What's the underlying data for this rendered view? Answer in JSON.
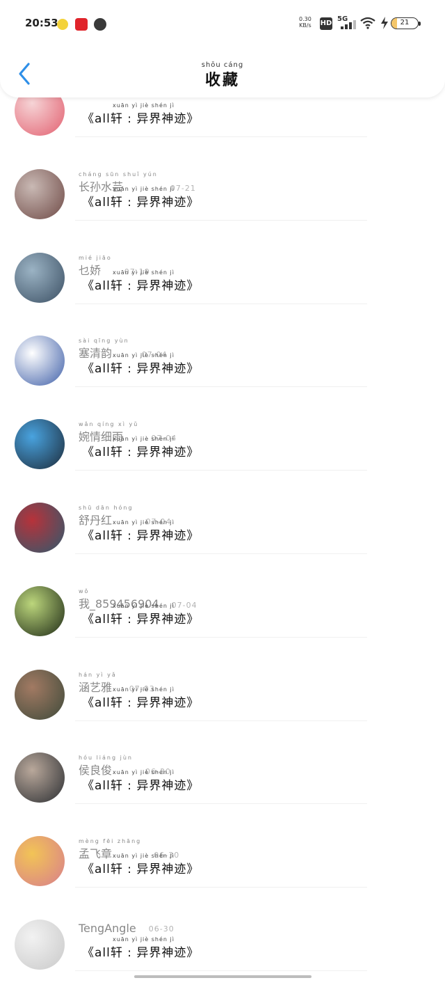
{
  "status": {
    "time": "20:53",
    "netspeed_value": "0.30",
    "netspeed_unit": "KB/s",
    "hd": "HD",
    "network": "5G",
    "battery": "21",
    "battery_level_pct": 21
  },
  "header": {
    "title_pinyin": "shōu cáng",
    "title": "收藏"
  },
  "quote": {
    "pinyin": "xuān         yì   jiè  shén  jì",
    "text": "《all轩 : 异界神迹》"
  },
  "items": [
    {
      "name_pinyin": "",
      "name": "",
      "date": "",
      "avatar_colors": [
        "#f6d4d6",
        "#e26070"
      ]
    },
    {
      "name_pinyin": "cháng sūn shuǐ yún",
      "name": "长孙水芸",
      "date": "07-21",
      "avatar_colors": [
        "#c9b9b4",
        "#6f4a46"
      ]
    },
    {
      "name_pinyin": "mié jiāo",
      "name": "乜娇",
      "date": "07-19",
      "avatar_colors": [
        "#9bb3c4",
        "#3b4f63"
      ]
    },
    {
      "name_pinyin": "sài qīng yùn",
      "name": "塞清韵",
      "date": "07-04",
      "avatar_colors": [
        "#ffffff",
        "#3f5fa8"
      ]
    },
    {
      "name_pinyin": "wǎn qíng xì yǔ",
      "name": "婉情细雨",
      "date": "07-04",
      "avatar_colors": [
        "#49a3df",
        "#1d2b3a"
      ]
    },
    {
      "name_pinyin": "shū dān hóng",
      "name": "舒丹红",
      "date": "07-04",
      "avatar_colors": [
        "#b7323a",
        "#2e5a6e"
      ]
    },
    {
      "name_pinyin": "wǒ",
      "name": "我_859456904",
      "date": "07-04",
      "avatar_colors": [
        "#bcd67c",
        "#1e2a16"
      ]
    },
    {
      "name_pinyin": "hán yì yǎ",
      "name": "涵艺雅",
      "date": "07-03",
      "avatar_colors": [
        "#a27a63",
        "#3e4a3a"
      ]
    },
    {
      "name_pinyin": "hóu liáng jùn",
      "name": "侯良俊",
      "date": "06-30",
      "avatar_colors": [
        "#b9a89b",
        "#2b2e32"
      ]
    },
    {
      "name_pinyin": "mèng fēi zhāng",
      "name": "孟飞章",
      "date": "06-30",
      "avatar_colors": [
        "#f2c456",
        "#d87e8c"
      ]
    },
    {
      "name_pinyin": "",
      "name": "TengAngle",
      "date": "06-30",
      "avatar_colors": [
        "#f2f2f2",
        "#c9c9c9"
      ]
    }
  ]
}
